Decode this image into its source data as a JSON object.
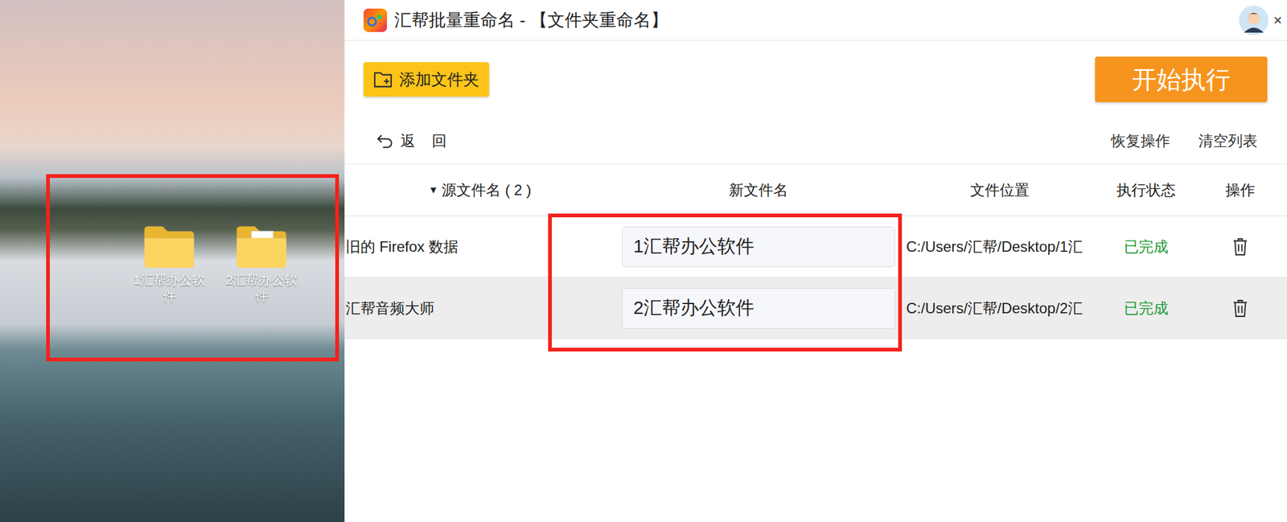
{
  "desktop": {
    "icons": [
      {
        "label": "1汇帮办公软件",
        "kind": "folder"
      },
      {
        "label": "2汇帮办公软件",
        "kind": "folder-doc"
      }
    ]
  },
  "window": {
    "title": "汇帮批量重命名 - 【文件夹重命名】",
    "close": "×"
  },
  "toolbar": {
    "add_button": "添加文件夹",
    "start_button": "开始执行"
  },
  "nav": {
    "back": "返 回",
    "actions": [
      "恢复操作",
      "清空列表"
    ]
  },
  "table": {
    "sort_icon": "▼",
    "columns": [
      "源文件名 ( 2 )",
      "新文件名",
      "文件位置",
      "执行状态",
      "操作"
    ],
    "rows": [
      {
        "source": "旧的 Firefox 数据",
        "new_name": "1汇帮办公软件",
        "location": "C:/Users/汇帮/Desktop/1汇",
        "status": "已完成",
        "selected": false
      },
      {
        "source": "汇帮音频大师",
        "new_name": "2汇帮办公软件",
        "location": "C:/Users/汇帮/Desktop/2汇",
        "status": "已完成",
        "selected": true
      }
    ]
  }
}
